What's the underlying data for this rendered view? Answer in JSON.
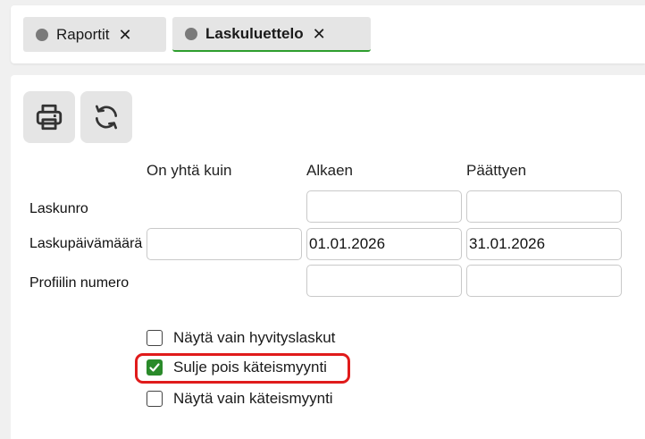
{
  "tabs": [
    {
      "label": "Raportit",
      "close": "✕"
    },
    {
      "label": "Laskuluettelo",
      "close": "✕"
    }
  ],
  "toolbar": {
    "print_icon": "printer-icon",
    "refresh_icon": "refresh-icon"
  },
  "columns": {
    "equals": "On yhtä kuin",
    "from": "Alkaen",
    "to": "Päättyen"
  },
  "rows": [
    {
      "label": "Laskunro",
      "equals": "",
      "from": "",
      "to": ""
    },
    {
      "label": "Laskupäivämäärä",
      "equals": "",
      "from": "01.01.2026",
      "to": "31.01.2026"
    },
    {
      "label": "Profiilin numero",
      "equals": "",
      "from": "",
      "to": ""
    }
  ],
  "options": [
    {
      "label": "Näytä vain hyvityslaskut",
      "checked": false
    },
    {
      "label": "Sulje pois käteismyynti",
      "checked": true
    },
    {
      "label": "Näytä vain käteismyynti",
      "checked": false
    }
  ],
  "colors": {
    "active_tab_underline": "#2e9e2e",
    "checkbox_checked": "#2a8a2a",
    "highlight": "#e01b1b"
  }
}
